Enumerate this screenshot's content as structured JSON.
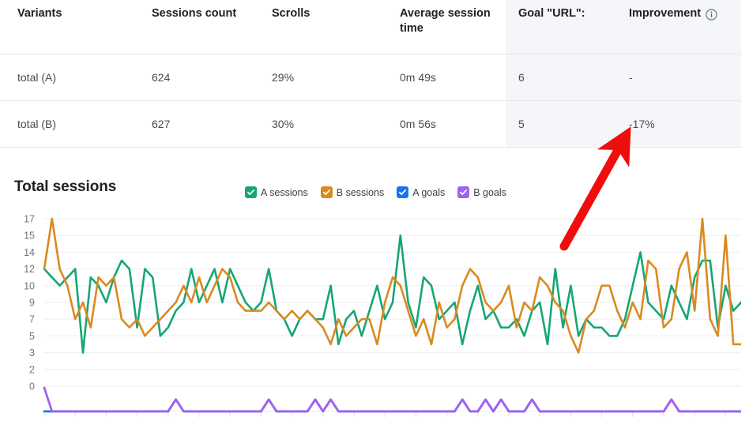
{
  "table": {
    "columns": [
      {
        "key": "variants",
        "label": "Variants",
        "highlight": false,
        "info": false
      },
      {
        "key": "sessions",
        "label": "Sessions count",
        "highlight": false,
        "info": false
      },
      {
        "key": "scrolls",
        "label": "Scrolls",
        "highlight": false,
        "info": false
      },
      {
        "key": "avgtime",
        "label": "Average session time",
        "highlight": false,
        "info": false
      },
      {
        "key": "goal",
        "label": "Goal \"URL\":",
        "highlight": true,
        "info": false
      },
      {
        "key": "improvement",
        "label": "Improvement",
        "highlight": true,
        "info": true
      }
    ],
    "headers": {
      "variants": "Variants",
      "sessions": "Sessions count",
      "scrolls": "Scrolls",
      "avgtime": "Average session time",
      "goal": "Goal \"URL\":",
      "improvement": "Improvement"
    },
    "rows": [
      {
        "variants": "total (A)",
        "sessions": "624",
        "scrolls": "29%",
        "avgtime": "0m 49s",
        "goal": "6",
        "improvement": "-"
      },
      {
        "variants": "total (B)",
        "sessions": "627",
        "scrolls": "30%",
        "avgtime": "0m 56s",
        "goal": "5",
        "improvement": "-17%"
      }
    ],
    "highlight_color": "#f4f6f9",
    "negative_color": "#d93f4c"
  },
  "chart": {
    "title": "Total sessions",
    "legend": [
      {
        "label": "A sessions",
        "color": "#17a673"
      },
      {
        "label": "B sessions",
        "color": "#d98a21"
      },
      {
        "label": "A goals",
        "color": "#1a73e8"
      },
      {
        "label": "B goals",
        "color": "#a35ff0"
      }
    ]
  },
  "annotation": {
    "type": "arrow",
    "color": "#f00d0d",
    "points_to": "-17%"
  },
  "chart_data": {
    "type": "line",
    "title": "Total sessions",
    "xlabel": "",
    "ylabel": "",
    "grid": true,
    "legend_position": "top-center",
    "ytick_labels": [
      17,
      15,
      14,
      12,
      10,
      9,
      7,
      5,
      3,
      2,
      0
    ],
    "ylim": [
      0,
      17
    ],
    "x": [
      1,
      2,
      3,
      4,
      5,
      6,
      7,
      8,
      9,
      10,
      11,
      12,
      13,
      14,
      15,
      16,
      17,
      18,
      19,
      20,
      21,
      22,
      23,
      24,
      25,
      26,
      27,
      28,
      29,
      30,
      31,
      32,
      33,
      34,
      35,
      36,
      37,
      38,
      39,
      40,
      41,
      42,
      43,
      44,
      45,
      46,
      47,
      48,
      49,
      50,
      51,
      52,
      53,
      54,
      55,
      56,
      57,
      58,
      59,
      60,
      61,
      62,
      63,
      64,
      65,
      66,
      67,
      68,
      69,
      70,
      71,
      72,
      73,
      74,
      75,
      76,
      77,
      78,
      79,
      80,
      81,
      82,
      83,
      84,
      85,
      86,
      87,
      88,
      89,
      90,
      91
    ],
    "series": [
      {
        "name": "A sessions",
        "color": "#17a673",
        "values": [
          12,
          11,
          10,
          11,
          12,
          3,
          11,
          10,
          9,
          11,
          13,
          12,
          6,
          12,
          11,
          5,
          6,
          8,
          9,
          12,
          9,
          10,
          12,
          9,
          12,
          10,
          9,
          8,
          9,
          12,
          8,
          7,
          5,
          7,
          8,
          7,
          7,
          10,
          4,
          7,
          8,
          5,
          8,
          10,
          7,
          9,
          15,
          9,
          6,
          11,
          10,
          7,
          8,
          9,
          4,
          8,
          10,
          7,
          8,
          6,
          6,
          7,
          5,
          8,
          9,
          4,
          12,
          6,
          10,
          5,
          7,
          6,
          6,
          5,
          5,
          7,
          10,
          14,
          9,
          8,
          7,
          10,
          9,
          7,
          11,
          13,
          13,
          6,
          10,
          8,
          9
        ]
      },
      {
        "name": "B sessions",
        "color": "#d98a21",
        "values": [
          12,
          17,
          12,
          10,
          7,
          9,
          6,
          11,
          10,
          11,
          7,
          6,
          7,
          5,
          6,
          7,
          8,
          9,
          10,
          9,
          11,
          9,
          10,
          12,
          11,
          9,
          8,
          8,
          8,
          9,
          8,
          7,
          8,
          7,
          8,
          7,
          6,
          4,
          7,
          5,
          6,
          7,
          7,
          4,
          9,
          11,
          10,
          8,
          5,
          7,
          4,
          9,
          6,
          7,
          10,
          12,
          11,
          9,
          8,
          9,
          10,
          6,
          9,
          8,
          11,
          10,
          9,
          8,
          5,
          3,
          7,
          8,
          10,
          10,
          8,
          6,
          9,
          7,
          13,
          12,
          6,
          7,
          12,
          14,
          8,
          17,
          7,
          5,
          15,
          4,
          4
        ]
      },
      {
        "name": "A goals",
        "color": "#1a73e8",
        "values": [
          0,
          0,
          0,
          0,
          0,
          0,
          0,
          0,
          0,
          0,
          0,
          0,
          0,
          0,
          0,
          0,
          0,
          1,
          0,
          0,
          0,
          0,
          0,
          0,
          0,
          0,
          0,
          0,
          0,
          1,
          0,
          0,
          0,
          0,
          0,
          1,
          0,
          1,
          0,
          0,
          0,
          0,
          0,
          0,
          0,
          0,
          0,
          0,
          0,
          0,
          0,
          0,
          0,
          0,
          1,
          0,
          0,
          1,
          0,
          1,
          0,
          0,
          0,
          1,
          0,
          0,
          0,
          0,
          0,
          0,
          0,
          0,
          0,
          0,
          0,
          0,
          0,
          0,
          0,
          0,
          0,
          1,
          0,
          0,
          0,
          0,
          0,
          0,
          0,
          0,
          0
        ]
      },
      {
        "name": "B goals",
        "color": "#a35ff0",
        "values": [
          2,
          0,
          0,
          0,
          0,
          0,
          0,
          0,
          0,
          0,
          0,
          0,
          0,
          0,
          0,
          0,
          0,
          1,
          0,
          0,
          0,
          0,
          0,
          0,
          0,
          0,
          0,
          0,
          0,
          1,
          0,
          0,
          0,
          0,
          0,
          1,
          0,
          1,
          0,
          0,
          0,
          0,
          0,
          0,
          0,
          0,
          0,
          0,
          0,
          0,
          0,
          0,
          0,
          0,
          1,
          0,
          0,
          1,
          0,
          1,
          0,
          0,
          0,
          1,
          0,
          0,
          0,
          0,
          0,
          0,
          0,
          0,
          0,
          0,
          0,
          0,
          0,
          0,
          0,
          0,
          0,
          1,
          0,
          0,
          0,
          0,
          0,
          0,
          0,
          0,
          0
        ]
      }
    ]
  }
}
